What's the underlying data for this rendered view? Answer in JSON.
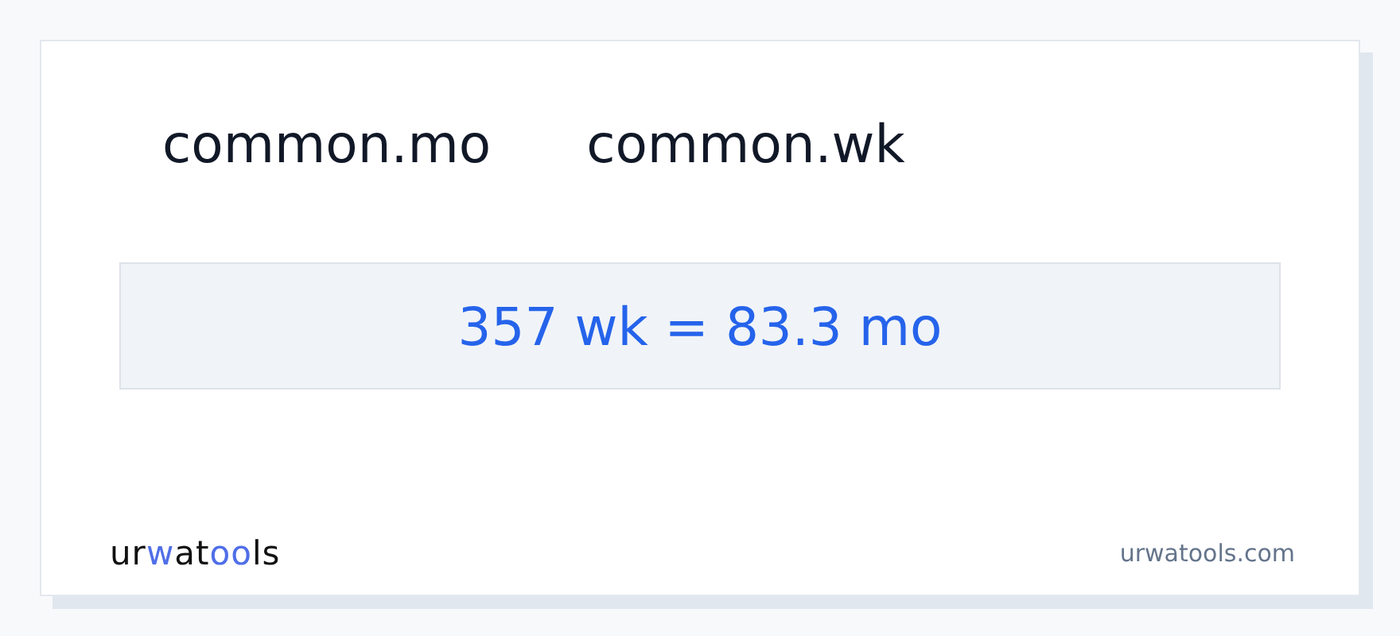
{
  "units": [
    {
      "label": "common.mo"
    },
    {
      "label": "common.wk"
    }
  ],
  "result": "357 wk = 83.3 mo",
  "logo": [
    {
      "text": "ur",
      "accent": false
    },
    {
      "text": "w",
      "accent": true
    },
    {
      "text": "at",
      "accent": false
    },
    {
      "text": "oo",
      "accent": true
    },
    {
      "text": "ls",
      "accent": false
    }
  ],
  "site": "urwatools.com"
}
